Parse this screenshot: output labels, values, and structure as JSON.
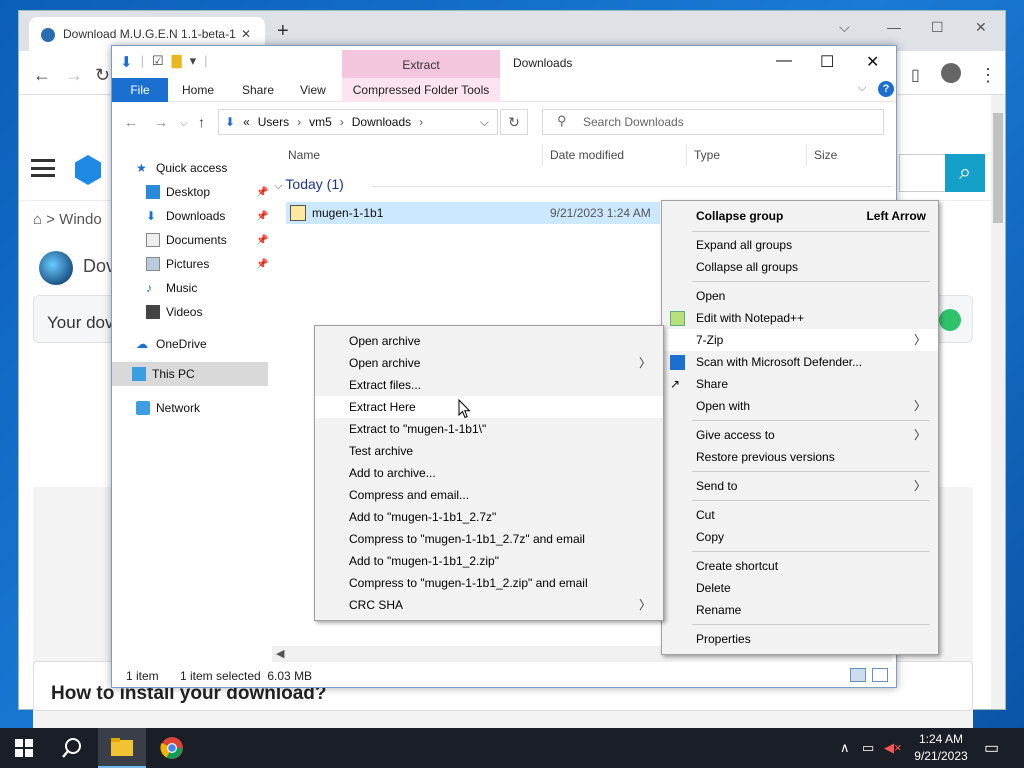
{
  "browser": {
    "tab_title": "Download M.U.G.E.N 1.1-beta-1",
    "new_tab": "+",
    "close_tab": "✕"
  },
  "site": {
    "breadcrumb": "> Windo",
    "app_title": "Dov",
    "card_text": "Your dov",
    "howto": "How to install your download?"
  },
  "explorer": {
    "extract_tab": "Extract",
    "window_title": "Downloads",
    "ribbon": {
      "file": "File",
      "home": "Home",
      "share": "Share",
      "view": "View",
      "compressed": "Compressed Folder Tools"
    },
    "address": {
      "prefix": "«",
      "crumbs": [
        "Users",
        "vm5",
        "Downloads"
      ]
    },
    "search_placeholder": "Search Downloads",
    "nav": {
      "quick_access": "Quick access",
      "desktop": "Desktop",
      "downloads": "Downloads",
      "documents": "Documents",
      "pictures": "Pictures",
      "music": "Music",
      "videos": "Videos",
      "onedrive": "OneDrive",
      "thispc": "This PC",
      "network": "Network"
    },
    "columns": {
      "name": "Name",
      "date": "Date modified",
      "type": "Type",
      "size": "Size"
    },
    "group": "Today (1)",
    "file": {
      "name": "mugen-1-1b1",
      "date": "9/21/2023 1:24 AM"
    },
    "status": {
      "items": "1 item",
      "selected": "1 item selected  6.03 MB"
    }
  },
  "context_menu": {
    "collapse_group": "Collapse group",
    "collapse_shortcut": "Left Arrow",
    "expand_all": "Expand all groups",
    "collapse_all": "Collapse all groups",
    "open": "Open",
    "edit_notepad": "Edit with Notepad++",
    "zip7": "7-Zip",
    "scan": "Scan with Microsoft Defender...",
    "share": "Share",
    "open_with": "Open with",
    "give_access": "Give access to",
    "restore": "Restore previous versions",
    "send_to": "Send to",
    "cut": "Cut",
    "copy": "Copy",
    "create_shortcut": "Create shortcut",
    "delete": "Delete",
    "rename": "Rename",
    "properties": "Properties"
  },
  "submenu_7zip": {
    "open_archive": "Open archive",
    "open_archive2": "Open archive",
    "extract_files": "Extract files...",
    "extract_here": "Extract Here",
    "extract_to": "Extract to \"mugen-1-1b1\\\"",
    "test": "Test archive",
    "add": "Add to archive...",
    "compress_email": "Compress and email...",
    "add_7z": "Add to \"mugen-1-1b1_2.7z\"",
    "compress_7z_email": "Compress to \"mugen-1-1b1_2.7z\" and email",
    "add_zip": "Add to \"mugen-1-1b1_2.zip\"",
    "compress_zip_email": "Compress to \"mugen-1-1b1_2.zip\" and email",
    "crc": "CRC SHA"
  },
  "taskbar": {
    "time": "1:24 AM",
    "date": "9/21/2023"
  },
  "colors": {
    "accent": "#1a6fd0",
    "extract_tab": "#f4c6de",
    "selection": "#cce8ff",
    "taskbar": "#1a1e26"
  }
}
